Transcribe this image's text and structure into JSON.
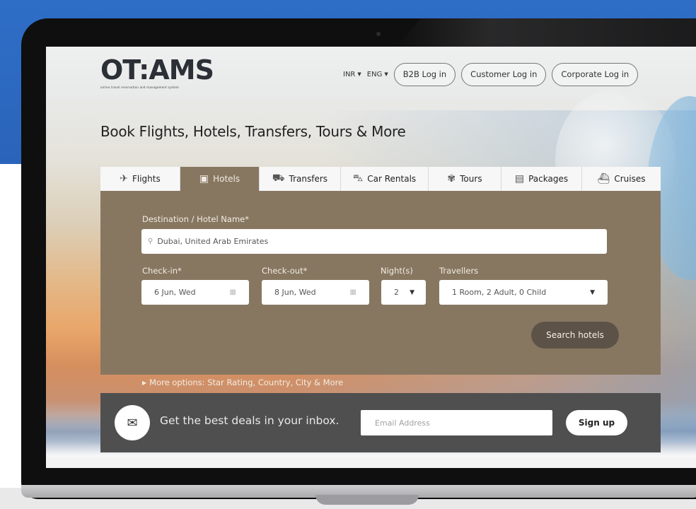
{
  "site": {
    "logo": "OT:AMS",
    "tagline": "online travel reservation and management system"
  },
  "topnav": {
    "currency": "INR",
    "language": "ENG",
    "b2b_login": "B2B Log in",
    "customer_login": "Customer Log in",
    "corporate_login": "Corporate Log in"
  },
  "headline": "Book Flights, Hotels, Transfers, Tours & More",
  "tabs": [
    {
      "label": "Flights",
      "icon": "plane-icon",
      "active": false
    },
    {
      "label": "Hotels",
      "icon": "hotel-icon",
      "active": true
    },
    {
      "label": "Transfers",
      "icon": "bus-icon",
      "active": false
    },
    {
      "label": "Car Rentals",
      "icon": "car-icon",
      "active": false
    },
    {
      "label": "Tours",
      "icon": "palm-icon",
      "active": false
    },
    {
      "label": "Packages",
      "icon": "package-icon",
      "active": false
    },
    {
      "label": "Cruises",
      "icon": "ship-icon",
      "active": false
    }
  ],
  "search": {
    "destination_label": "Destination / Hotel Name*",
    "destination_value": "Dubai, United Arab Emirates",
    "checkin_label": "Check-in*",
    "checkin_value": "6 Jun, Wed",
    "checkout_label": "Check-out*",
    "checkout_value": "8 Jun, Wed",
    "nights_label": "Night(s)",
    "nights_value": "2",
    "travellers_label": "Travellers",
    "travellers_value": "1 Room, 2 Adult, 0 Child",
    "more_options": "More options: Star Rating, Country, City & More",
    "search_button": "Search hotels"
  },
  "newsletter": {
    "text": "Get the best deals in your inbox.",
    "email_placeholder": "Email Address",
    "signup_button": "Sign up"
  },
  "colors": {
    "accent_brown": "#877761",
    "dark_button": "#5d5247",
    "newsletter_bg": "#4f4f4f",
    "outer_blue": "#2f6ec7"
  }
}
